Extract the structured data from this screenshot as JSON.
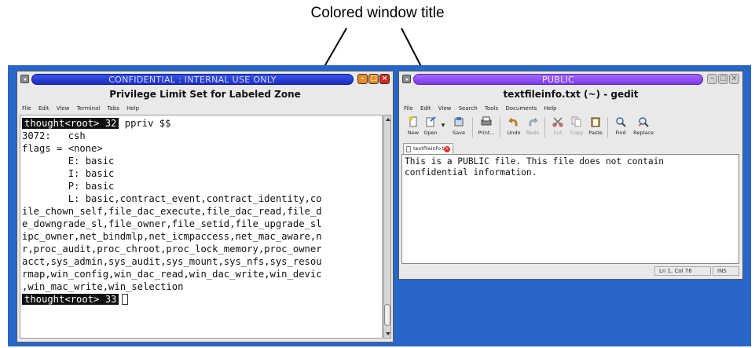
{
  "caption": "Colored window title",
  "terminal": {
    "title": "CONFIDENTIAL : INTERNAL USE ONLY",
    "subtitle": "Privilege Limit Set for Labeled Zone",
    "menu": [
      "File",
      "Edit",
      "View",
      "Terminal",
      "Tabs",
      "Help"
    ],
    "prompt1": "thought<root> 32",
    "command": "ppriv $$",
    "lines": [
      "3072:   csh",
      "flags = <none>",
      "        E: basic",
      "        I: basic",
      "        P: basic",
      "        L: basic,contract_event,contract_identity,co",
      "ile_chown_self,file_dac_execute,file_dac_read,file_d",
      "e_downgrade_sl,file_owner,file_setid,file_upgrade_sl",
      "ipc_owner,net_bindmlp,net_icmpaccess,net_mac_aware,n",
      "r,proc_audit,proc_chroot,proc_lock_memory,proc_owner",
      "acct,sys_admin,sys_audit,sys_mount,sys_nfs,sys_resou",
      "rmap,win_config,win_dac_read,win_dac_write,win_devic",
      ",win_mac_write,win_selection"
    ],
    "prompt2": "thought<root> 33"
  },
  "gedit": {
    "title": "PUBLIC",
    "subtitle": "textfileinfo.txt (~) - gedit",
    "menu": [
      "File",
      "Edit",
      "View",
      "Search",
      "Tools",
      "Documents",
      "Help"
    ],
    "toolbar": [
      "New",
      "Open",
      "Save",
      "Print...",
      "Undo",
      "Redo",
      "Cut",
      "Copy",
      "Paste",
      "Find",
      "Replace"
    ],
    "tab_label": "textfileinfo.txt",
    "content": [
      "This is a PUBLIC file. This file does not contain",
      "confidential information."
    ],
    "status_position": "Ln 1, Col 76",
    "status_mode": "INS"
  },
  "colors": {
    "desktop": "#2866c8",
    "confidential_title": "#2a3fd8",
    "public_title": "#9350f5",
    "close_button": "#d8281a",
    "window_buttons": "#f08a1c"
  }
}
